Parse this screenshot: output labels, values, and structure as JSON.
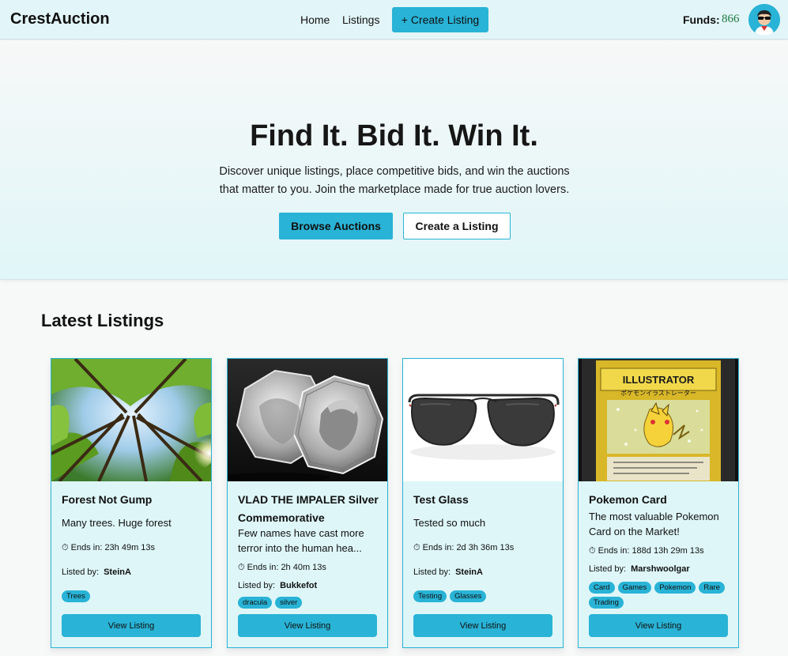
{
  "nav": {
    "brand": "CrestAuction",
    "home": "Home",
    "listings": "Listings",
    "create": "+ Create Listing",
    "funds_label": "Funds:",
    "funds_value": "866"
  },
  "hero": {
    "title": "Find It. Bid It. Win It.",
    "text": "Discover unique listings, place competitive bids, and win the auctions that matter to you. Join the marketplace made for true auction lovers.",
    "browse": "Browse Auctions",
    "create": "Create a Listing"
  },
  "section_title": "Latest Listings",
  "listings": [
    {
      "title": "Forest Not Gump",
      "desc": "Many trees. Huge forest",
      "ends": "⏱ Ends in: 23h 49m 13s",
      "by_label": "Listed by:",
      "by": "SteinA",
      "tags": [
        "Trees"
      ],
      "button": "View Listing"
    },
    {
      "title": "VLAD THE IMPALER Silver Commemorative",
      "desc": "Few names have cast more terror into the human hea...",
      "ends": "⏱ Ends in: 2h 40m 13s",
      "by_label": "Listed by:",
      "by": "Bukkefot",
      "tags": [
        "dracula",
        "silver"
      ],
      "button": "View Listing"
    },
    {
      "title": "Test Glass",
      "desc": "Tested so much",
      "ends": "⏱ Ends in: 2d 3h 36m 13s",
      "by_label": "Listed by:",
      "by": "SteinA",
      "tags": [
        "Testing",
        "Glasses"
      ],
      "button": "View Listing"
    },
    {
      "title": "Pokemon Card",
      "desc": "The most valuable Pokemon Card on the Market!",
      "ends": "⏱ Ends in: 188d 13h 29m 13s",
      "by_label": "Listed by:",
      "by": "Marshwoolgar",
      "tags": [
        "Card",
        "Games",
        "Pokemon",
        "Rare",
        "Trading"
      ],
      "button": "View Listing",
      "image_text": [
        "ILLUSTRATOR",
        "ポケモンイラストレーター"
      ]
    }
  ],
  "colors": {
    "accent": "#29b3d6",
    "card_bg": "#def6f8",
    "funds": "#1f7a3e"
  }
}
